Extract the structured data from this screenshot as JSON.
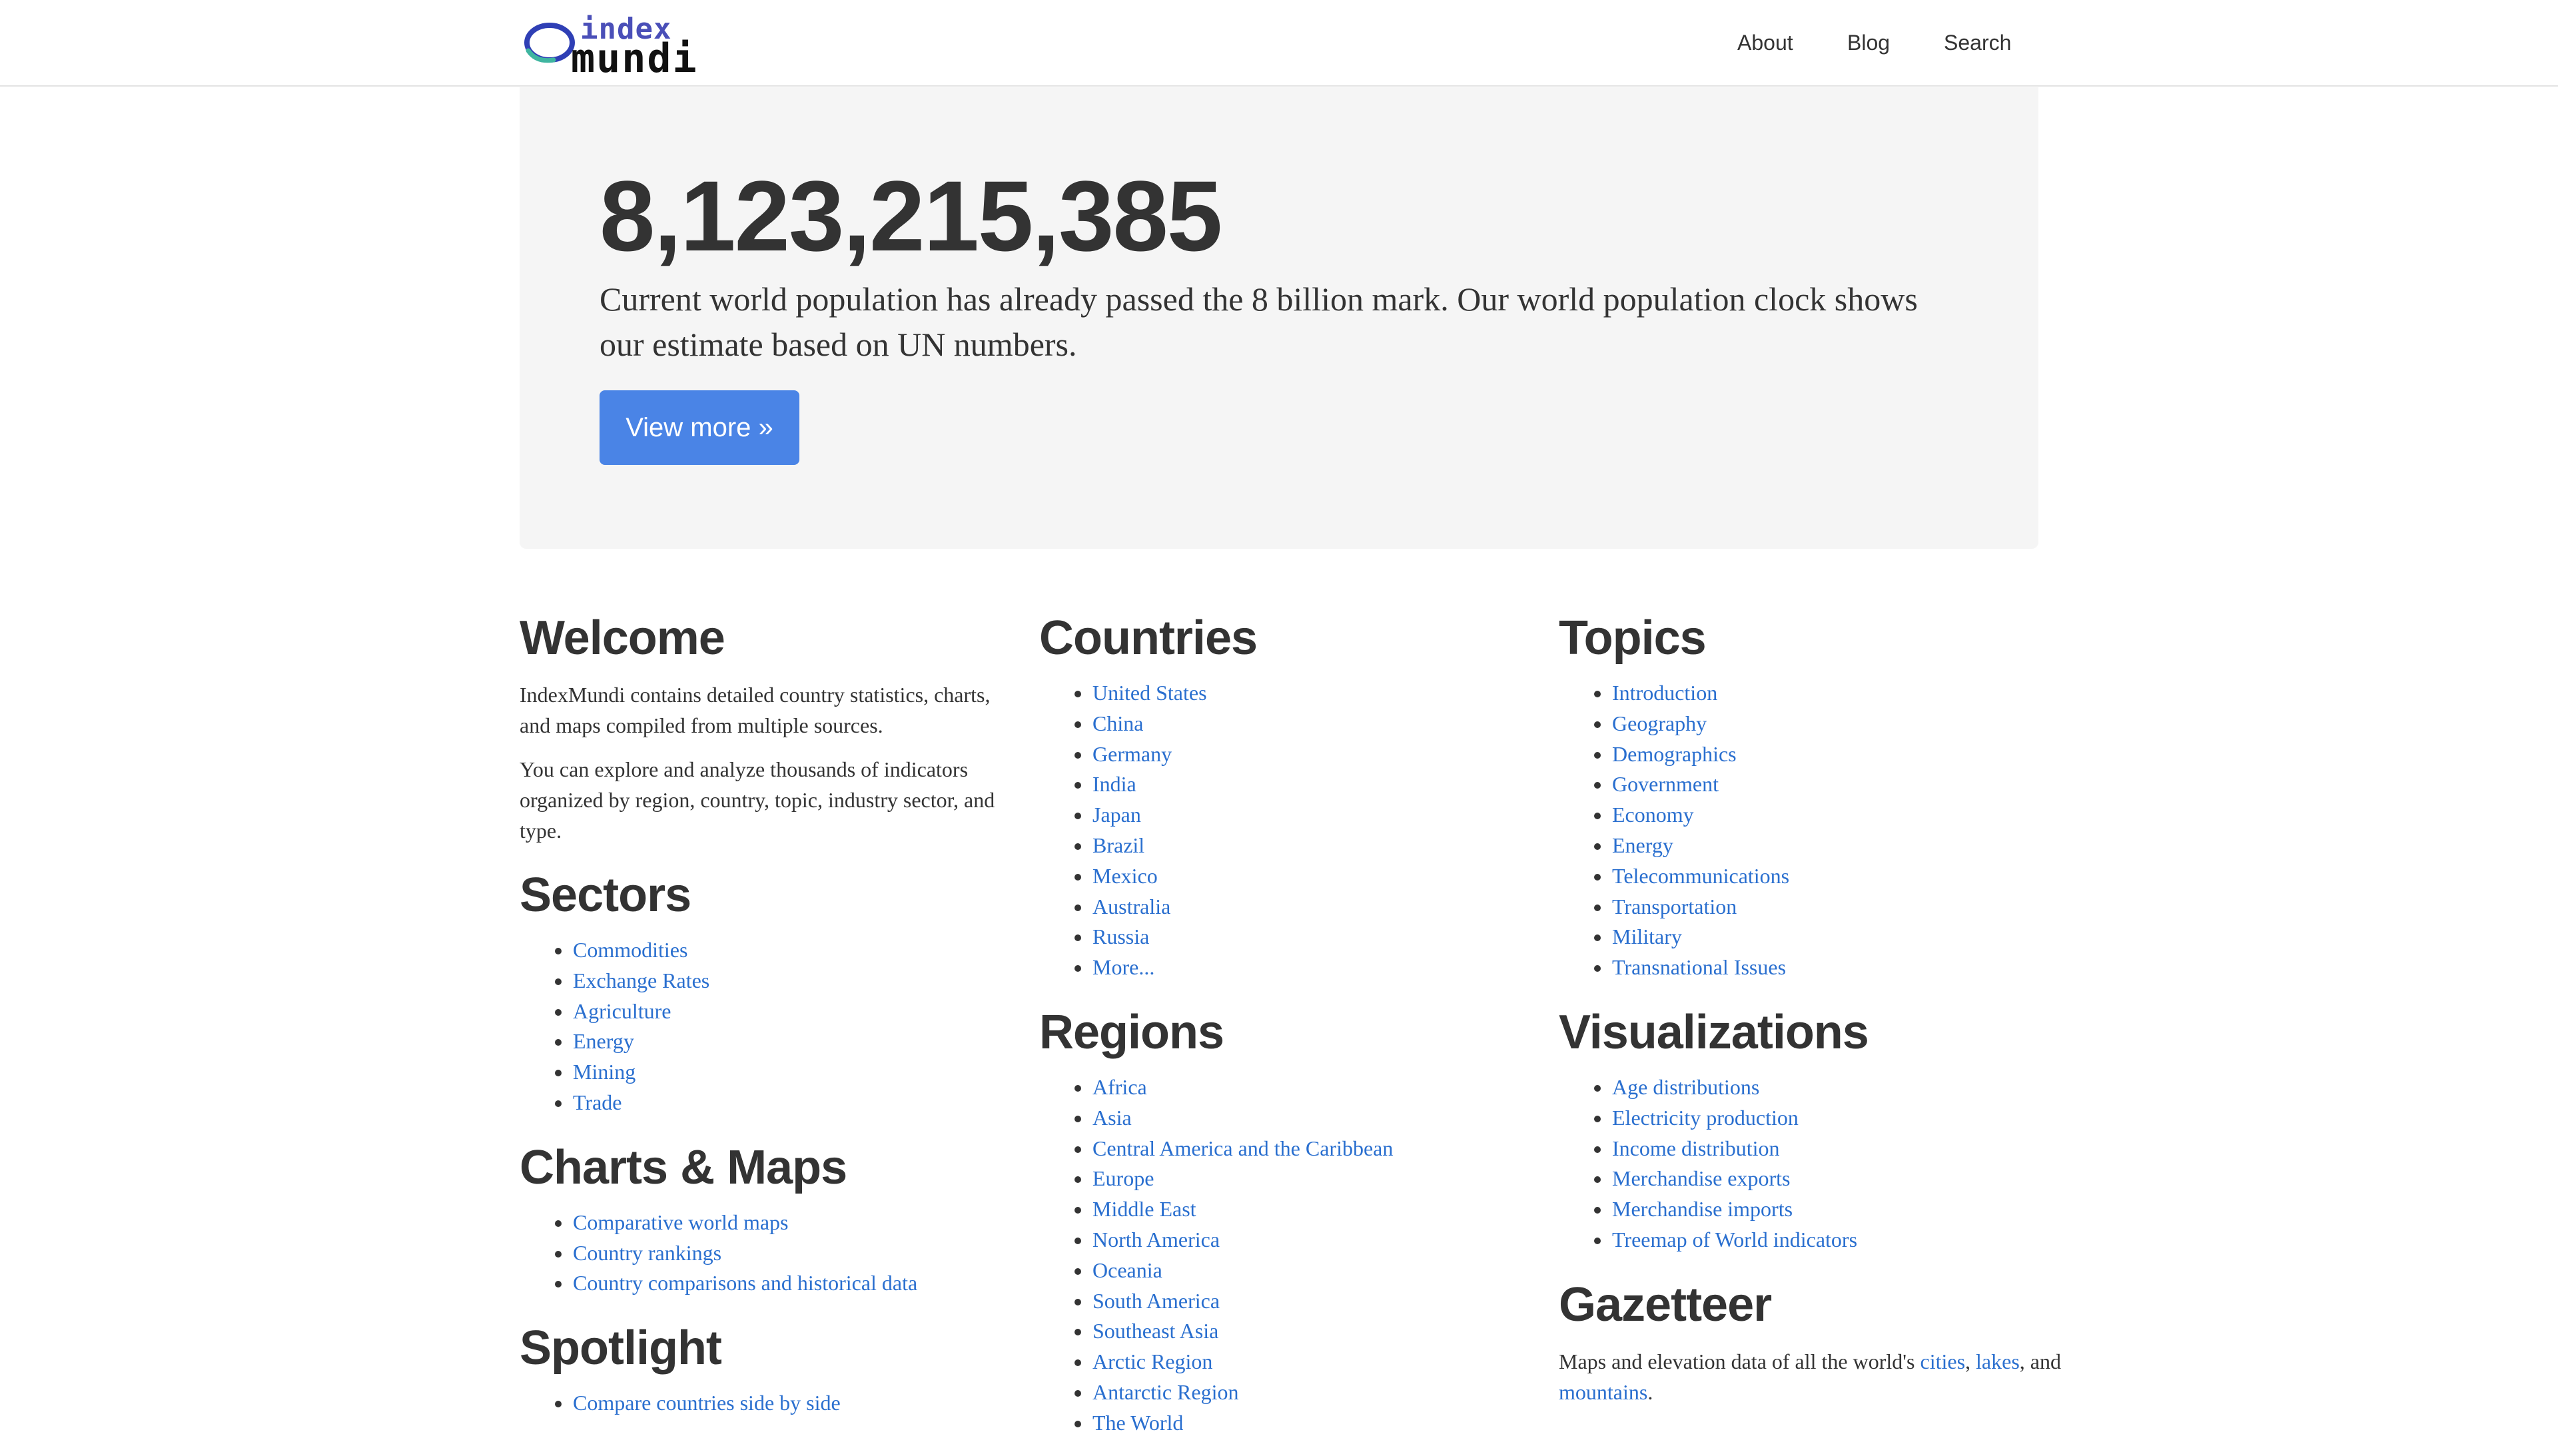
{
  "brand": {
    "top": "index",
    "bottom": "mundi",
    "ring_color": "#2f3fb5",
    "ring_accent": "#3fb5a0"
  },
  "nav": {
    "about": "About",
    "blog": "Blog",
    "search": "Search"
  },
  "hero": {
    "count": "8,123,215,385",
    "text": "Current world population has already passed the 8 billion mark. Our world population clock shows our estimate based on UN numbers.",
    "button": "View more »"
  },
  "welcome": {
    "title": "Welcome",
    "p1": "IndexMundi contains detailed country statistics, charts, and maps compiled from multiple sources.",
    "p2": "You can explore and analyze thousands of indicators organized by region, country, topic, industry sector, and type."
  },
  "sectors": {
    "title": "Sectors",
    "items": [
      "Commodities",
      "Exchange Rates",
      "Agriculture",
      "Energy",
      "Mining",
      "Trade"
    ]
  },
  "charts_maps": {
    "title": "Charts & Maps",
    "items": [
      "Comparative world maps",
      "Country rankings",
      "Country comparisons and historical data"
    ]
  },
  "spotlight": {
    "title": "Spotlight",
    "items": [
      "Compare countries side by side"
    ]
  },
  "countries": {
    "title": "Countries",
    "items": [
      "United States",
      "China",
      "Germany",
      "India",
      "Japan",
      "Brazil",
      "Mexico",
      "Australia",
      "Russia",
      "More..."
    ]
  },
  "regions": {
    "title": "Regions",
    "items": [
      "Africa",
      "Asia",
      "Central America and the Caribbean",
      "Europe",
      "Middle East",
      "North America",
      "Oceania",
      "South America",
      "Southeast Asia",
      "Arctic Region",
      "Antarctic Region",
      "The World"
    ]
  },
  "topics": {
    "title": "Topics",
    "items": [
      "Introduction",
      "Geography",
      "Demographics",
      "Government",
      "Economy",
      "Energy",
      "Telecommunications",
      "Transportation",
      "Military",
      "Transnational Issues"
    ]
  },
  "visualizations": {
    "title": "Visualizations",
    "items": [
      "Age distributions",
      "Electricity production",
      "Income distribution",
      "Merchandise exports",
      "Merchandise imports",
      "Treemap of World indicators"
    ]
  },
  "gazetteer": {
    "title": "Gazetteer",
    "prefix": "Maps and elevation data of all the world's ",
    "cities": "cities",
    "sep1": ",",
    "lakes": "lakes",
    "sep2": ", and ",
    "mountains": "mountains",
    "suffix": "."
  },
  "colors": {
    "link": "#2a6fcf",
    "button": "#4a84e6",
    "hero_bg": "#f5f5f5",
    "text": "#333333"
  }
}
